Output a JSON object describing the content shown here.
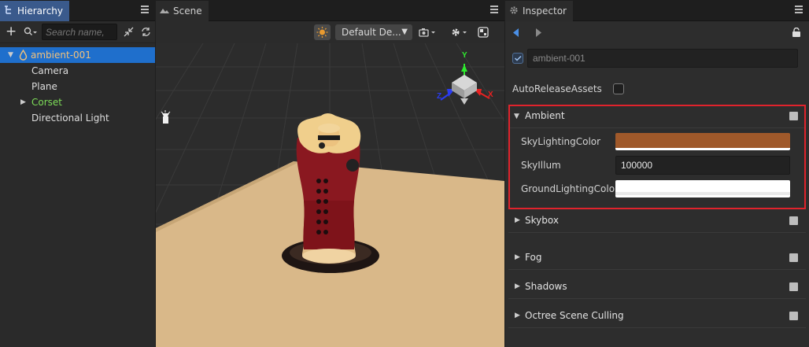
{
  "hierarchy": {
    "tab_label": "Hierarchy",
    "search_placeholder": "Search name,",
    "items": [
      {
        "label": "ambient-001"
      },
      {
        "label": "Camera"
      },
      {
        "label": "Plane"
      },
      {
        "label": "Corset"
      },
      {
        "label": "Directional Light"
      }
    ]
  },
  "scene": {
    "tab_label": "Scene",
    "camera_select": "Default De..."
  },
  "gizmo": {
    "x": "X",
    "y": "Y",
    "z": "Z"
  },
  "inspector": {
    "tab_label": "Inspector",
    "node_name": "ambient-001",
    "auto_release_label": "AutoReleaseAssets",
    "ambient": {
      "title": "Ambient",
      "sky_lighting_label": "SkyLightingColor",
      "sky_lighting_color": "#a0592a",
      "sky_illum_label": "SkyIllum",
      "sky_illum_value": "100000",
      "ground_lighting_label": "GroundLightingColor",
      "ground_lighting_color": "#ffffff"
    },
    "sections": [
      {
        "label": "Skybox"
      },
      {
        "label": "Fog"
      },
      {
        "label": "Shadows"
      },
      {
        "label": "Octree Scene Culling"
      }
    ]
  },
  "colors": {
    "accent_blue": "#1f6fcc",
    "highlight_red": "#e0232c",
    "selected_text": "#f4c27a",
    "prefab_green": "#7ddc58"
  }
}
